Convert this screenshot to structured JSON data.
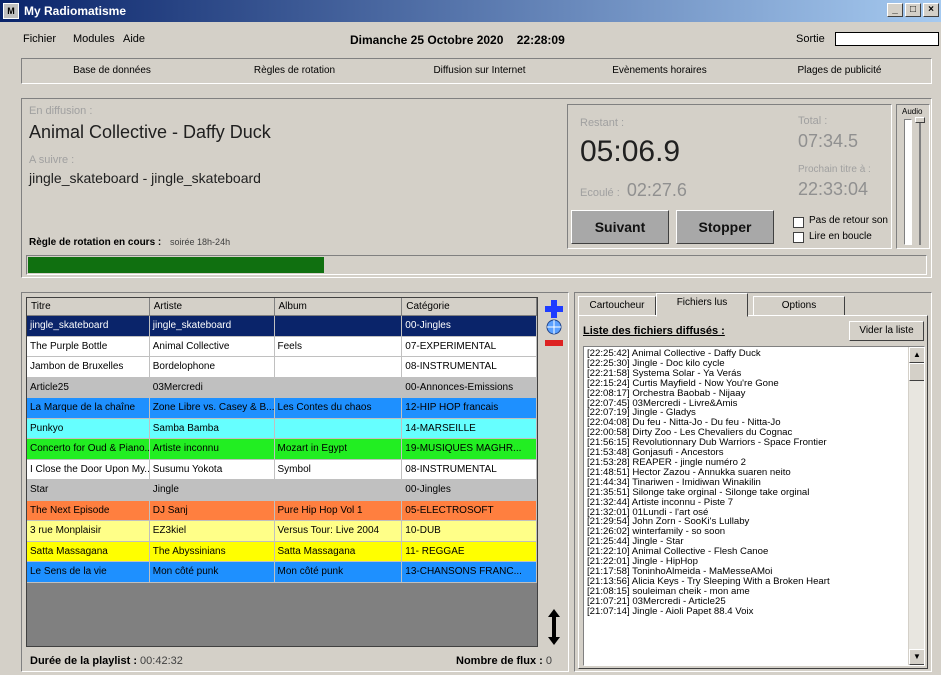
{
  "window": {
    "title": "My Radiomatisme",
    "icon_text": "M"
  },
  "menu": {
    "items": [
      "Fichier",
      "Modules",
      "Aide"
    ],
    "datetime": "Dimanche 25 Octobre 2020    22:28:09",
    "sortie_label": "Sortie"
  },
  "nav": [
    "Base de données",
    "Règles de rotation",
    "Diffusion sur Internet",
    "Evènements horaires",
    "Plages de publicité"
  ],
  "now": {
    "on_air_label": "En diffusion :",
    "on_air_title": "Animal Collective - Daffy Duck",
    "next_label": "A suivre :",
    "next_title": "jingle_skateboard - jingle_skateboard",
    "rotation_label": "Règle de rotation en cours :",
    "rotation_value": "soirée 18h-24h",
    "progress_fraction": 0.33
  },
  "timer": {
    "remaining_label": "Restant :",
    "remaining": "05:06.9",
    "elapsed_label": "Ecoulé :",
    "elapsed": "02:27.6",
    "total_label": "Total :",
    "total": "07:34.5",
    "next_track_label": "Prochain titre à :",
    "next_track_time": "22:33:04",
    "next_button": "Suivant",
    "stop_button": "Stopper",
    "opt_no_return": "Pas de retour son",
    "opt_loop": "Lire en boucle",
    "audio_label": "Audio"
  },
  "playlist": {
    "columns": [
      "Titre",
      "Artiste",
      "Album",
      "Catégorie"
    ],
    "rows": [
      {
        "cells": [
          "jingle_skateboard",
          "jingle_skateboard",
          "",
          "00-Jingles"
        ],
        "bg": "#0a246a",
        "fg": "#ffffff"
      },
      {
        "cells": [
          "The Purple Bottle",
          "Animal Collective",
          "Feels",
          "07-EXPERIMENTAL"
        ],
        "bg": "#ffffff",
        "fg": "#000000"
      },
      {
        "cells": [
          "Jambon de Bruxelles",
          "Bordelophone",
          "",
          "08-INSTRUMENTAL"
        ],
        "bg": "#ffffff",
        "fg": "#000000"
      },
      {
        "cells": [
          "Article25",
          "03Mercredi",
          "",
          "00-Annonces-Emissions"
        ],
        "bg": "#c0c0c0",
        "fg": "#000000"
      },
      {
        "cells": [
          "La Marque de la chaîne",
          "Zone Libre vs. Casey & B...",
          "Les Contes du chaos",
          "12-HIP HOP francais"
        ],
        "bg": "#1e90ff",
        "fg": "#000000"
      },
      {
        "cells": [
          "Punkyo",
          "Samba Bamba",
          "",
          "14-MARSEILLE"
        ],
        "bg": "#66ffff",
        "fg": "#000000"
      },
      {
        "cells": [
          "Concerto for Oud & Piano...",
          "Artiste inconnu",
          "Mozart in Egypt",
          "19-MUSIQUES MAGHR..."
        ],
        "bg": "#22ee22",
        "fg": "#000000"
      },
      {
        "cells": [
          "I Close the Door Upon My...",
          "Susumu Yokota",
          "Symbol",
          "08-INSTRUMENTAL"
        ],
        "bg": "#ffffff",
        "fg": "#000000"
      },
      {
        "cells": [
          "Star",
          "Jingle",
          "",
          "00-Jingles"
        ],
        "bg": "#c0c0c0",
        "fg": "#000000"
      },
      {
        "cells": [
          "The Next Episode",
          "DJ Sanj",
          "Pure Hip Hop Vol 1",
          "05-ELECTROSOFT"
        ],
        "bg": "#ff7f3f",
        "fg": "#000000"
      },
      {
        "cells": [
          "3 rue Monplaisir",
          "EZ3kiel",
          "Versus Tour: Live 2004",
          "10-DUB"
        ],
        "bg": "#ffff88",
        "fg": "#000000"
      },
      {
        "cells": [
          "Satta Massagana",
          "The Abyssinians",
          "Satta Massagana",
          "11- REGGAE"
        ],
        "bg": "#ffff00",
        "fg": "#000000"
      },
      {
        "cells": [
          "Le Sens de la vie",
          "Mon côté punk",
          "Mon côté punk",
          "13-CHANSONS FRANC..."
        ],
        "bg": "#1e90ff",
        "fg": "#000000"
      }
    ],
    "duration_label": "Durée de la playlist :",
    "duration_value": "00:42:32",
    "flux_label": "Nombre de flux :",
    "flux_value": "0"
  },
  "right": {
    "tabs": [
      "Cartoucheur",
      "Fichiers lus",
      "Options"
    ],
    "active_tab": 1,
    "list_title": "Liste des fichiers diffusés :",
    "clear_button": "Vider la liste",
    "log": [
      "[22:25:42]  Animal Collective - Daffy Duck",
      "[22:25:30]  Jingle - Doc kilo cycle",
      "[22:21:58]  Systema Solar - Ya Verás",
      "[22:15:24]  Curtis Mayfield - Now You're Gone",
      "[22:08:17]  Orchestra Baobab - Nijaay",
      "[22:07:45]  03Mercredi - Livre&Amis",
      "[22:07:19]  Jingle - Gladys",
      "[22:04:08]  Du feu - Nitta-Jo - Du feu - Nitta-Jo",
      "[22:00:58]  Dirty Zoo - Les Chevaliers du Cognac",
      "[21:56:15]  Revolutionnary Dub Warriors - Space Frontier",
      "[21:53:48]  Gonjasufi - Ancestors",
      "[21:53:28]  REAPER - jingle numéro 2",
      "[21:48:51]  Hector Zazou - Annukka suaren neito",
      "[21:44:34]  Tinariwen - Imidiwan Winakilin",
      "[21:35:51]  Silonge take orginal - Silonge take orginal",
      "[21:32:44]  Artiste inconnu - Piste 7",
      "[21:32:01]  01Lundi - l'art osé",
      "[21:29:54]  John Zorn - SooKi's Lullaby",
      "[21:26:02]  winterfamily - so soon",
      "[21:25:44]  Jingle - Star",
      "[21:22:10]  Animal Collective - Flesh Canoe",
      "[21:22:01]  Jingle - HipHop",
      "[21:17:58]  ToninhoAlmeida - MaMesseAMoi",
      "[21:13:56]  Alicia Keys - Try Sleeping With a Broken Heart",
      "[21:08:15]  souleiman cheik - mon ame",
      "[21:07:21]  03Mercredi - Article25",
      "[21:07:14]  Jingle - Aioli Papet 88.4 Voix"
    ]
  }
}
